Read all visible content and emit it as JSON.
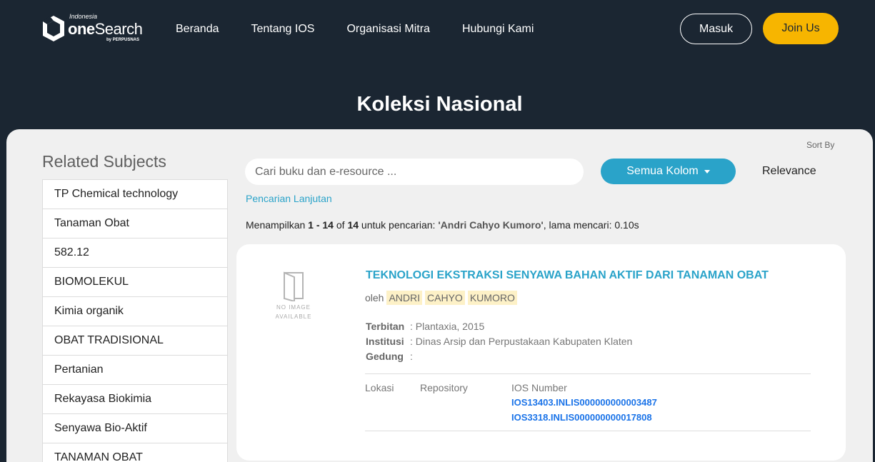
{
  "header": {
    "logo": {
      "small": "Indonesia",
      "main_bold": "one",
      "main_rest": "Search",
      "by": "by PERPUSNAS"
    },
    "nav": [
      "Beranda",
      "Tentang IOS",
      "Organisasi Mitra",
      "Hubungi Kami"
    ],
    "login_label": "Masuk",
    "join_label": "Join Us",
    "page_title": "Koleksi Nasional"
  },
  "colors": {
    "header_bg": "#1b2632",
    "accent": "#2aa3c9",
    "join": "#f7b500",
    "link": "#1a73e8"
  },
  "sidebar": {
    "title": "Related Subjects",
    "items": [
      "TP Chemical technology",
      "Tanaman Obat",
      "582.12",
      "BIOMOLEKUL",
      "Kimia organik",
      "OBAT TRADISIONAL",
      "Pertanian",
      "Rekayasa Biokimia",
      "Senyawa Bio-Aktif",
      "TANAMAN OBAT"
    ]
  },
  "search": {
    "placeholder": "Cari buku dan e-resource ...",
    "column_label": "Semua Kolom",
    "sort_by_label": "Sort By",
    "sort_value": "Relevance",
    "advanced_label": "Pencarian Lanjutan"
  },
  "result_info": {
    "prefix": "Menampilkan",
    "range": "1 - 14",
    "of": "of",
    "total": "14",
    "mid": "untuk pencarian:",
    "query": "'Andri Cahyo Kumoro'",
    "suffix": ", lama mencari: 0.10s"
  },
  "result": {
    "no_image_text_1": "NO IMAGE",
    "no_image_text_2": "AVAILABLE",
    "title": "TEKNOLOGI EKSTRAKSI SENYAWA BAHAN AKTIF DARI TANAMAN OBAT",
    "by_label": "oleh",
    "authors": [
      "ANDRI",
      "CAHYO",
      "KUMORO"
    ],
    "meta": [
      {
        "key": "Terbitan",
        "value": ": Plantaxia, 2015"
      },
      {
        "key": "Institusi",
        "value": ": Dinas Arsip dan Perpustakaan Kabupaten Klaten"
      },
      {
        "key": "Gedung",
        "value": ":"
      }
    ],
    "columns": {
      "lokasi": "Lokasi",
      "repository": "Repository",
      "ios_number": "IOS Number"
    },
    "ios_numbers": [
      "IOS13403.INLIS000000000003487",
      "IOS3318.INLIS000000000017808"
    ]
  }
}
